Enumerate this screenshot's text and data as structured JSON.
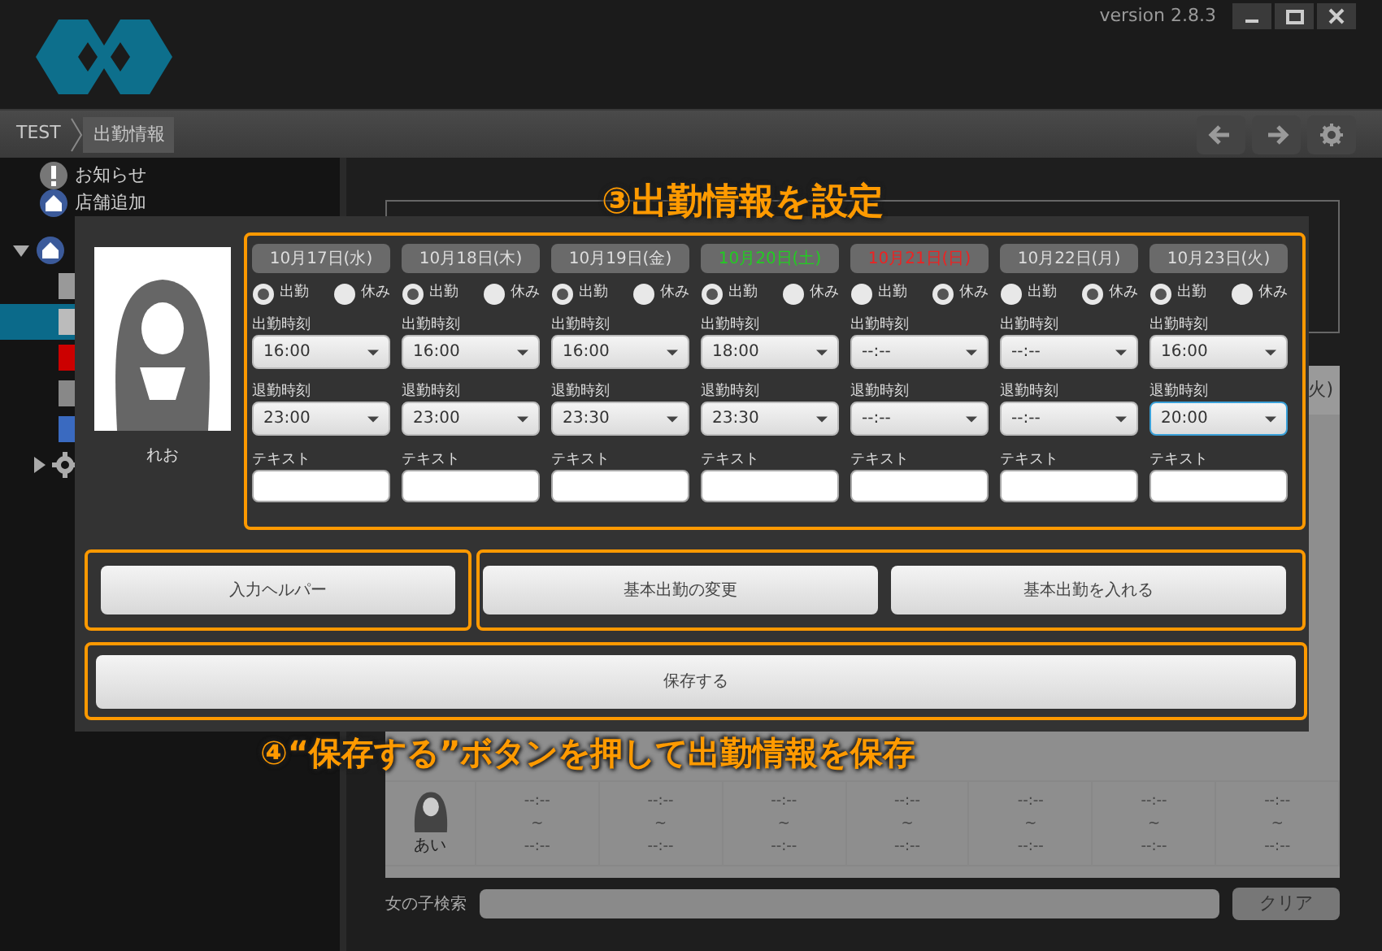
{
  "app": {
    "version": "version 2.8.3"
  },
  "breadcrumb": [
    "TEST",
    "出勤情報"
  ],
  "sidebar": {
    "items": [
      {
        "label": "お知らせ",
        "kind": "notice"
      },
      {
        "label": "店舗追加",
        "kind": "add"
      },
      {
        "kind": "group",
        "expanded": true,
        "children": [
          {
            "selected": false
          },
          {
            "selected": true
          },
          {
            "selected": false
          },
          {
            "selected": false
          },
          {
            "selected": false
          }
        ]
      },
      {
        "kind": "settings",
        "expanded": false
      }
    ]
  },
  "table": {
    "column_header": "火)",
    "rows": [
      {
        "name": "あい",
        "cells": [
          {
            "start": "--:--",
            "sep": "~",
            "end": "--:--"
          },
          {
            "start": "--:--",
            "sep": "~",
            "end": "--:--"
          },
          {
            "start": "--:--",
            "sep": "~",
            "end": "--:--"
          },
          {
            "start": "--:--",
            "sep": "~",
            "end": "--:--"
          },
          {
            "start": "--:--",
            "sep": "~",
            "end": "--:--"
          },
          {
            "start": "--:--",
            "sep": "~",
            "end": "--:--"
          },
          {
            "start": "--:--",
            "sep": "~",
            "end": "--:--"
          }
        ]
      }
    ]
  },
  "search": {
    "label": "女の子検索",
    "clear": "クリア"
  },
  "dialog": {
    "name": "れお",
    "days": [
      {
        "date": "10月17日(水)",
        "kind": "weekday",
        "working": true,
        "work_label": "出勤",
        "off_label": "休み",
        "start_label": "出勤時刻",
        "start": "16:00",
        "end_label": "退勤時刻",
        "end": "23:00",
        "focused": false,
        "text_label": "テキスト"
      },
      {
        "date": "10月18日(木)",
        "kind": "weekday",
        "working": true,
        "work_label": "出勤",
        "off_label": "休み",
        "start_label": "出勤時刻",
        "start": "16:00",
        "end_label": "退勤時刻",
        "end": "23:00",
        "focused": false,
        "text_label": "テキスト"
      },
      {
        "date": "10月19日(金)",
        "kind": "weekday",
        "working": true,
        "work_label": "出勤",
        "off_label": "休み",
        "start_label": "出勤時刻",
        "start": "16:00",
        "end_label": "退勤時刻",
        "end": "23:30",
        "focused": false,
        "text_label": "テキスト"
      },
      {
        "date": "10月20日(土)",
        "kind": "saturday",
        "working": true,
        "work_label": "出勤",
        "off_label": "休み",
        "start_label": "出勤時刻",
        "start": "18:00",
        "end_label": "退勤時刻",
        "end": "23:30",
        "focused": false,
        "text_label": "テキスト"
      },
      {
        "date": "10月21日(日)",
        "kind": "sunday",
        "working": false,
        "work_label": "出勤",
        "off_label": "休み",
        "start_label": "出勤時刻",
        "start": "--:--",
        "end_label": "退勤時刻",
        "end": "--:--",
        "focused": false,
        "text_label": "テキスト"
      },
      {
        "date": "10月22日(月)",
        "kind": "weekday",
        "working": false,
        "work_label": "出勤",
        "off_label": "休み",
        "start_label": "出勤時刻",
        "start": "--:--",
        "end_label": "退勤時刻",
        "end": "--:--",
        "focused": false,
        "text_label": "テキスト"
      },
      {
        "date": "10月23日(火)",
        "kind": "weekday",
        "working": true,
        "work_label": "出勤",
        "off_label": "休み",
        "start_label": "出勤時刻",
        "start": "16:00",
        "end_label": "退勤時刻",
        "end": "20:00",
        "focused": true,
        "text_label": "テキスト"
      }
    ],
    "buttons": {
      "helper": "入力ヘルパー",
      "change": "基本出勤の変更",
      "apply": "基本出勤を入れる",
      "save": "保存する"
    }
  },
  "annotations": [
    "③出勤情報を設定",
    "④“保存する”ボタンを押して出勤情報を保存"
  ]
}
